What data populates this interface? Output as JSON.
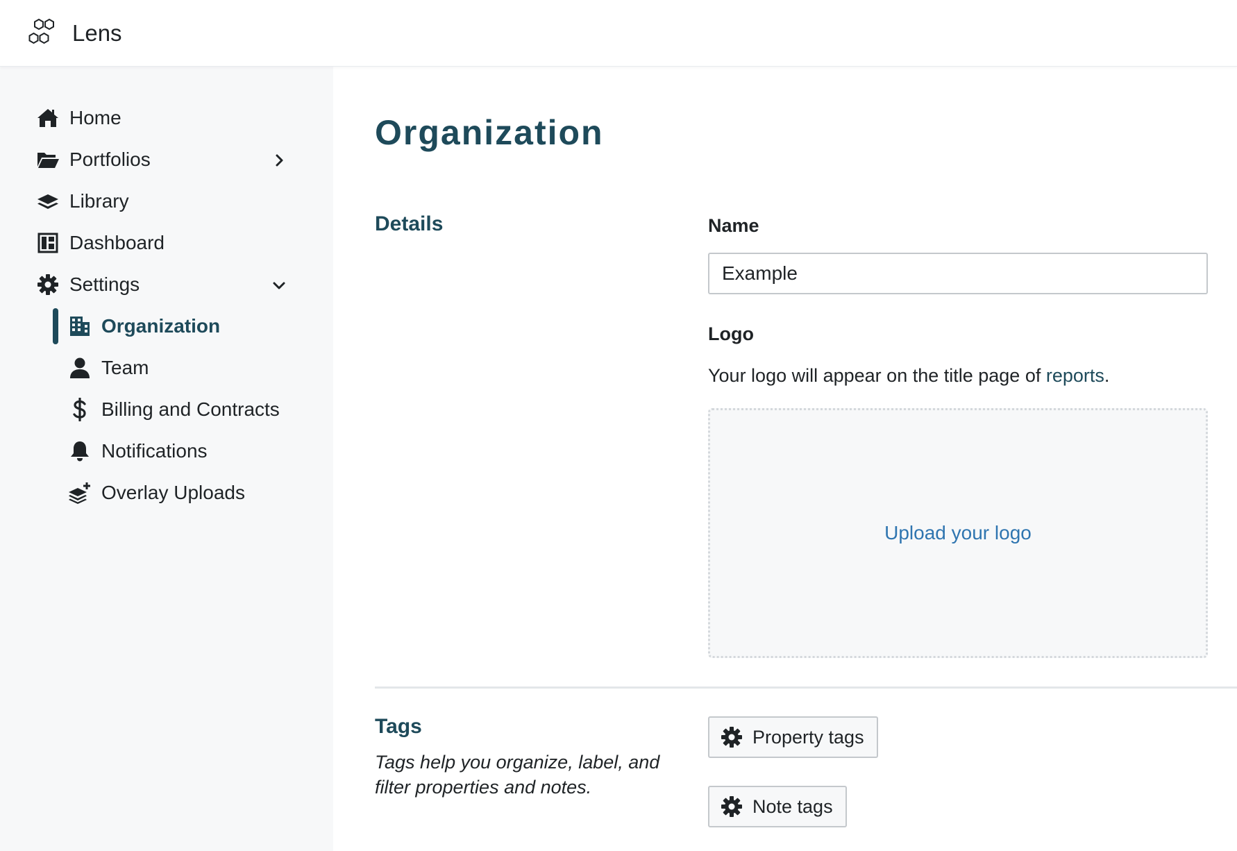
{
  "brand": {
    "name": "Lens",
    "logo_icon": "hexagons-logo-icon"
  },
  "sidebar": {
    "items": [
      {
        "label": "Home",
        "icon": "home-icon"
      },
      {
        "label": "Portfolios",
        "icon": "folder-icon",
        "chevron": "chevron-right-icon"
      },
      {
        "label": "Library",
        "icon": "layers-icon"
      },
      {
        "label": "Dashboard",
        "icon": "dashboard-icon"
      },
      {
        "label": "Settings",
        "icon": "gear-icon",
        "chevron": "chevron-down-icon"
      }
    ],
    "subitems": [
      {
        "label": "Organization",
        "icon": "building-icon",
        "active": true
      },
      {
        "label": "Team",
        "icon": "user-icon"
      },
      {
        "label": "Billing and Contracts",
        "icon": "dollar-icon"
      },
      {
        "label": "Notifications",
        "icon": "bell-icon"
      },
      {
        "label": "Overlay Uploads",
        "icon": "layers-plus-icon"
      }
    ]
  },
  "main": {
    "title": "Organization",
    "details": {
      "heading": "Details",
      "name_label": "Name",
      "name_value": "Example",
      "logo_label": "Logo",
      "logo_help_prefix": "Your logo will appear on the title page of ",
      "logo_help_link": "reports",
      "logo_help_suffix": ".",
      "upload_label": "Upload your logo"
    },
    "tags": {
      "heading": "Tags",
      "description": "Tags help you organize, label, and filter properties and notes.",
      "property_tags_label": "Property tags",
      "note_tags_label": "Note tags"
    }
  },
  "colors": {
    "accent": "#1e4a5a",
    "link": "#2f75b0",
    "sidebar_bg": "#f7f8f9"
  }
}
